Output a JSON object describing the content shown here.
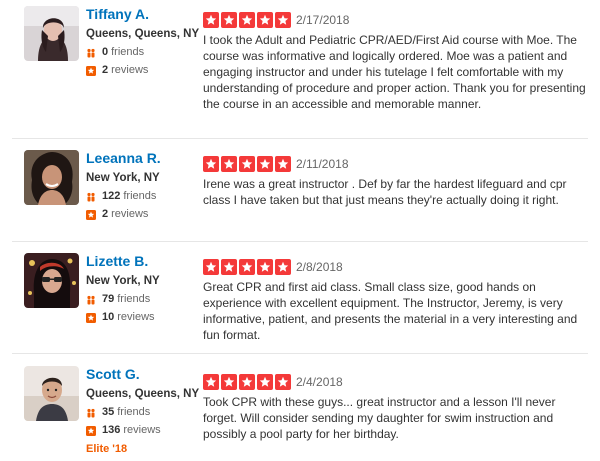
{
  "reviews": [
    {
      "user_name": "Tiffany A.",
      "location": "Queens, Queens, NY",
      "friends_count": "0",
      "friends_label": "friends",
      "reviews_count": "2",
      "reviews_label": "reviews",
      "elite": "",
      "rating": 5,
      "date": "2/17/2018",
      "text": "I took the Adult and Pediatric CPR/AED/First Aid course with Moe. The course was informative and logically ordered. Moe was a patient and engaging instructor and under his tutelage I felt comfortable with my understanding of procedure and proper action. Thank you for presenting the course in an accessible and memorable manner."
    },
    {
      "user_name": "Leeanna R.",
      "location": "New York, NY",
      "friends_count": "122",
      "friends_label": "friends",
      "reviews_count": "2",
      "reviews_label": "reviews",
      "elite": "",
      "rating": 5,
      "date": "2/11/2018",
      "text": "Irene was a great instructor . Def by far the hardest lifeguard and cpr class I have taken but that just means they're actually doing it right."
    },
    {
      "user_name": "Lizette B.",
      "location": "New York, NY",
      "friends_count": "79",
      "friends_label": "friends",
      "reviews_count": "10",
      "reviews_label": "reviews",
      "elite": "",
      "rating": 5,
      "date": "2/8/2018",
      "text": "Great CPR and first aid class.  Small class size, good hands on experience with excellent equipment.  The Instructor,  Jeremy,  is very informative,  patient,  and presents the material in a very interesting and fun format."
    },
    {
      "user_name": "Scott G.",
      "location": "Queens, Queens, NY",
      "friends_count": "35",
      "friends_label": "friends",
      "reviews_count": "136",
      "reviews_label": "reviews",
      "elite": "Elite '18",
      "rating": 5,
      "date": "2/4/2018",
      "text": "Took CPR with these guys... great instructor and a lesson I'll never forget.  Will consider sending my daughter for swim instruction and possibly a pool party for her birthday."
    }
  ],
  "colors": {
    "star_red": "#f43939",
    "link_blue": "#0073bb",
    "friends_icon": "#f15c00",
    "elite_orange": "#f15c00"
  }
}
